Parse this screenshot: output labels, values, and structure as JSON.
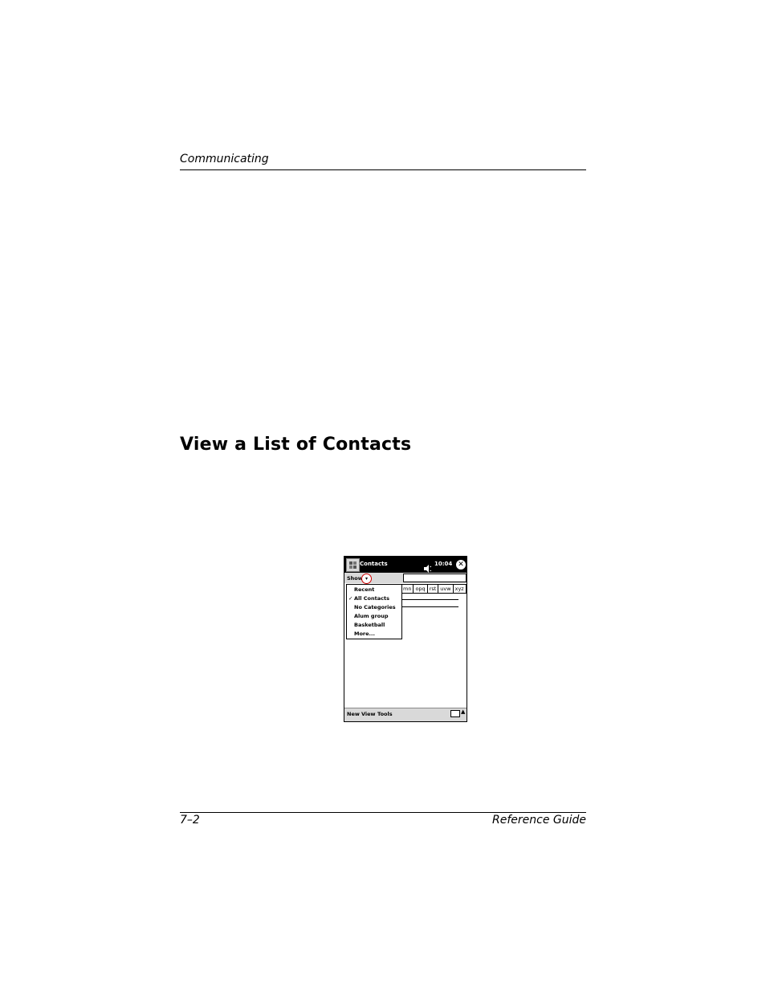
{
  "header": {
    "section": "Communicating"
  },
  "main": {
    "heading": "View a List of Contacts"
  },
  "footer": {
    "page_number": "7–2",
    "guide_title": "Reference Guide"
  },
  "screenshot": {
    "app_title": "Contacts",
    "clock": "10:04",
    "close_glyph": "✕",
    "show_label": "Show",
    "dropdown_glyph": "▾",
    "abc_tabs": [
      "mn",
      "opq",
      "rst",
      "uvw",
      "xyz"
    ],
    "menu": {
      "items": [
        "Recent",
        "All Contacts",
        "No Categories",
        "Alum group",
        "Basketball",
        "More..."
      ],
      "checked_index": 1,
      "check_glyph": "✓"
    },
    "command_bar": {
      "new": "New",
      "view": "View",
      "tools": "Tools",
      "up_glyph": "▲"
    }
  }
}
